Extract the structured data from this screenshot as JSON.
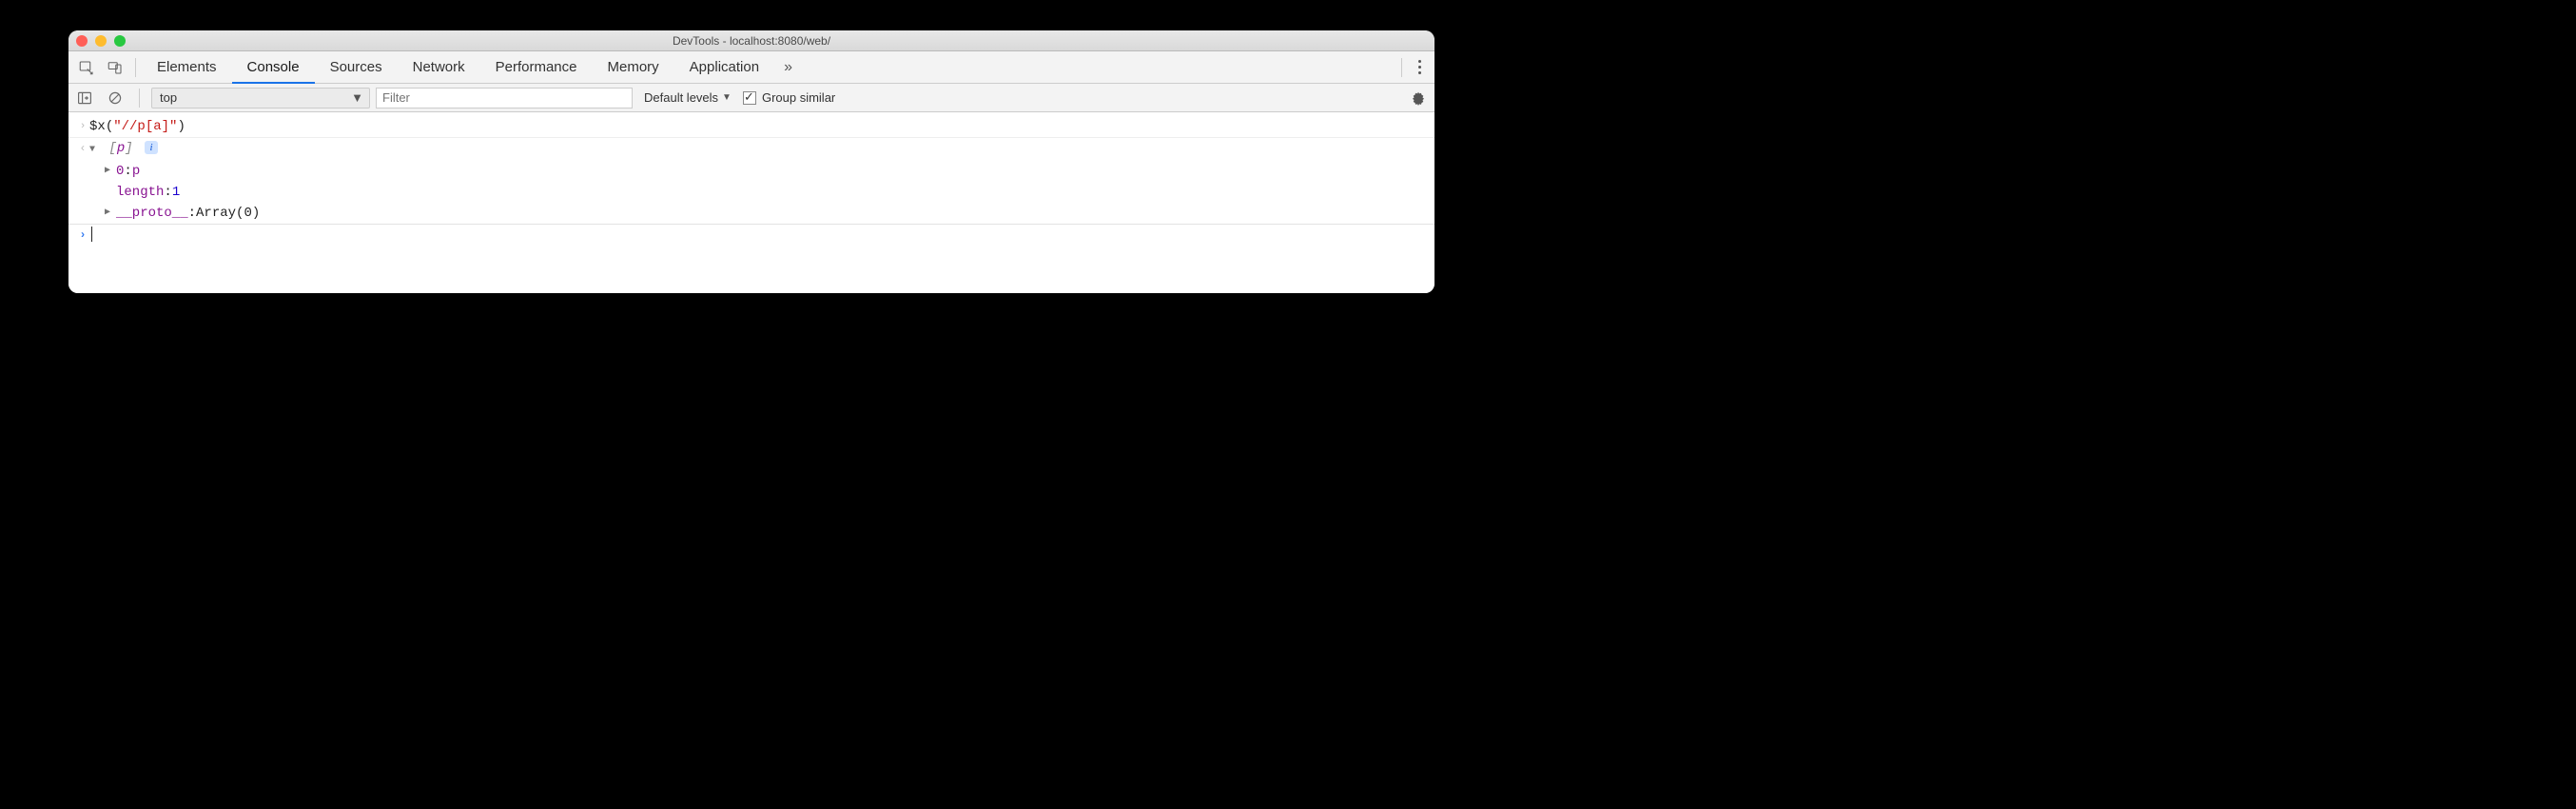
{
  "window": {
    "title": "DevTools - localhost:8080/web/"
  },
  "tabs": {
    "items": [
      "Elements",
      "Console",
      "Sources",
      "Network",
      "Performance",
      "Memory",
      "Application"
    ],
    "active_index": 1
  },
  "filterbar": {
    "context": "top",
    "filter_placeholder": "Filter",
    "levels_label": "Default levels",
    "group_similar_label": "Group similar",
    "group_similar_checked": true
  },
  "console": {
    "input_line": {
      "func": "$x",
      "open": "(",
      "string": "\"//p[a]\"",
      "close": ")"
    },
    "result": {
      "summary_open": "[",
      "summary_elem": "p",
      "summary_close": "]",
      "entries": [
        {
          "caret": "▶",
          "index": "0",
          "value": "p",
          "value_is_elem": true
        },
        {
          "caret": "",
          "key": "length",
          "value": "1",
          "value_is_num": true
        },
        {
          "caret": "▶",
          "key": "__proto__",
          "value": "Array(0)",
          "value_is_plain": true
        }
      ]
    }
  }
}
